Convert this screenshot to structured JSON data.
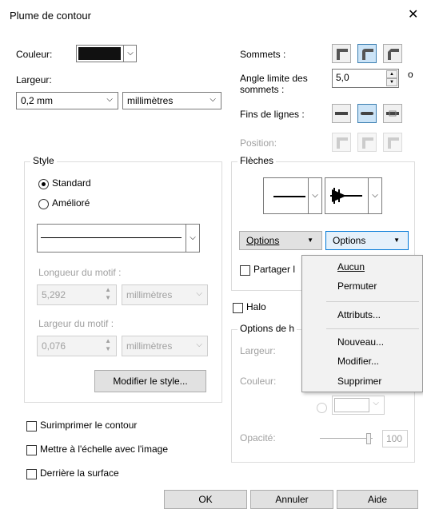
{
  "window": {
    "title": "Plume de contour",
    "close_glyph": "✕"
  },
  "left": {
    "color_label": "Couleur:",
    "color_value": "#111111",
    "width_label": "Largeur:",
    "width_value": "0,2 mm",
    "unit_value": "millimètres"
  },
  "right": {
    "corners_label": "Sommets :",
    "miter_label_1": "Angle limite des",
    "miter_label_2": "sommets :",
    "miter_value": "5,0",
    "miter_unit": "o",
    "line_caps_label": "Fins de lignes :",
    "position_label": "Position:"
  },
  "style_group": {
    "title": "Style",
    "standard_label": "Standard",
    "enhanced_label": "Amélioré",
    "dash_length_label": "Longueur du motif :",
    "dash_length_value": "5,292",
    "dash_length_unit": "millimètres",
    "dash_width_label": "Largeur du motif :",
    "dash_width_value": "0,076",
    "dash_width_unit": "millimètres",
    "edit_style_button": "Modifier le style..."
  },
  "arrows_group": {
    "title": "Flèches",
    "options_left": "Options",
    "options_right": "Options",
    "share_label": "Partager l"
  },
  "halo": {
    "halo_label": "Halo",
    "options_title": "Options de h",
    "width_label": "Largeur:",
    "color_label": "Couleur:",
    "opacity_label": "Opacité:",
    "opacity_value": "100"
  },
  "checks": {
    "overprint": "Surimprimer le contour",
    "scale_with_image": "Mettre à l'échelle avec l'image",
    "behind_fill": "Derrière la surface"
  },
  "footer": {
    "ok": "OK",
    "cancel": "Annuler",
    "help": "Aide"
  },
  "menu": {
    "none": "Aucun",
    "swap": "Permuter",
    "attributes": "Attributs...",
    "new": "Nouveau...",
    "edit": "Modifier...",
    "delete": "Supprimer"
  },
  "colors": {
    "selected_blue": "#cce4f7",
    "accent": "#3c7fb1"
  }
}
